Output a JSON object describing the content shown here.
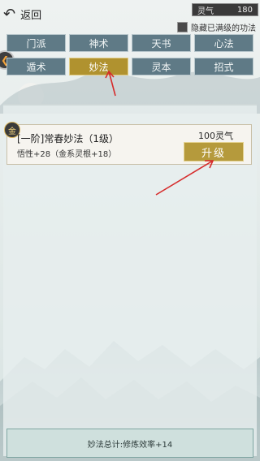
{
  "topbar": {
    "back_label": "返回",
    "qi_label": "灵气",
    "qi_value": "180",
    "hide_checkbox_label": "隐藏已满级的功法"
  },
  "tabs": [
    {
      "label": "门派",
      "active": false
    },
    {
      "label": "神术",
      "active": false
    },
    {
      "label": "天书",
      "active": false
    },
    {
      "label": "心法",
      "active": false
    },
    {
      "label": "遁术",
      "active": false
    },
    {
      "label": "妙法",
      "active": true
    },
    {
      "label": "灵本",
      "active": false
    },
    {
      "label": "招式",
      "active": false
    }
  ],
  "item": {
    "badge": "金",
    "name": "[一阶]常春妙法（1级）",
    "desc": "悟性+28（金系灵根+18）",
    "cost": "100灵气",
    "upgrade_label": "升级"
  },
  "footer": {
    "summary": "妙法总计:修炼效率+14"
  },
  "colors": {
    "active_tab": "#b0922f",
    "tab": "#5f7a86",
    "annotation_arrow": "#d62b2b"
  }
}
